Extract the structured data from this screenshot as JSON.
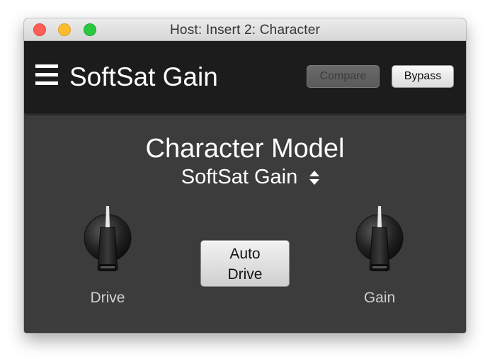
{
  "window": {
    "title": "Host: Insert 2: Character"
  },
  "header": {
    "menu_icon": "hamburger-menu-icon",
    "plugin_name": "SoftSat Gain",
    "compare_label": "Compare",
    "bypass_label": "Bypass"
  },
  "main": {
    "section_title": "Character Model",
    "model_selected": "SoftSat Gain",
    "model_stepper_icon": "up-down-arrows-icon",
    "auto_drive_line1": "Auto",
    "auto_drive_line2": "Drive",
    "knobs": [
      {
        "label": "Drive",
        "icon": "rotary-knob-icon"
      },
      {
        "label": "Gain",
        "icon": "rotary-knob-icon"
      }
    ]
  },
  "colors": {
    "header_bg": "#1c1c1c",
    "panel_bg": "#3c3c3c",
    "text": "#ffffff",
    "label": "#cfcfcf"
  }
}
